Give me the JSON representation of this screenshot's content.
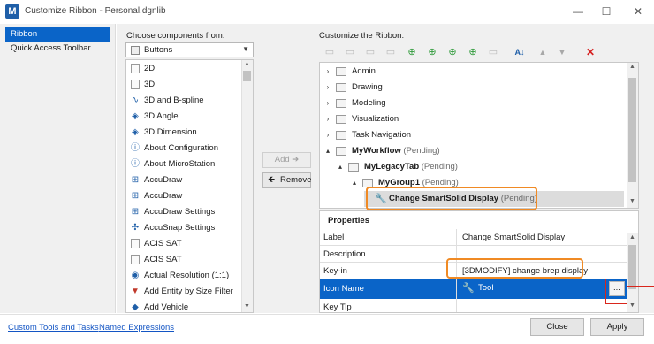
{
  "window": {
    "title": "Customize Ribbon - Personal.dgnlib",
    "app_icon_text": "M",
    "minimize": "—",
    "maximize": "☐",
    "close": "✕"
  },
  "nav": {
    "items": [
      {
        "label": "Ribbon",
        "selected": true
      },
      {
        "label": "Quick Access Toolbar",
        "selected": false
      }
    ]
  },
  "components": {
    "label": "Choose components from:",
    "dropdown_value": "Buttons",
    "items": [
      {
        "label": "2D",
        "icon": "box"
      },
      {
        "label": "3D",
        "icon": "box"
      },
      {
        "label": "3D and B-spline",
        "icon": "curve"
      },
      {
        "label": "3D Angle",
        "icon": "cube"
      },
      {
        "label": "3D Dimension",
        "icon": "cube"
      },
      {
        "label": "About Configuration",
        "icon": "info"
      },
      {
        "label": "About MicroStation",
        "icon": "info"
      },
      {
        "label": "AccuDraw",
        "icon": "accudraw"
      },
      {
        "label": "AccuDraw",
        "icon": "accudraw"
      },
      {
        "label": "AccuDraw Settings",
        "icon": "accudraw"
      },
      {
        "label": "AccuSnap Settings",
        "icon": "snap"
      },
      {
        "label": "ACIS SAT",
        "icon": "box"
      },
      {
        "label": "ACIS SAT",
        "icon": "box"
      },
      {
        "label": "Actual Resolution (1:1)",
        "icon": "resolution"
      },
      {
        "label": "Add Entity by Size Filter",
        "icon": "filter"
      },
      {
        "label": "Add Vehicle",
        "icon": "vehicle"
      }
    ]
  },
  "middle_buttons": {
    "add": "Add ➔",
    "remove": "Remove"
  },
  "ribbon": {
    "label": "Customize the Ribbon:",
    "tree": [
      {
        "label": "Admin",
        "pending": "",
        "expander": "›",
        "indent": 0,
        "bold": false
      },
      {
        "label": "Drawing",
        "pending": "",
        "expander": "›",
        "indent": 0,
        "bold": false
      },
      {
        "label": "Modeling",
        "pending": "",
        "expander": "›",
        "indent": 0,
        "bold": false
      },
      {
        "label": "Visualization",
        "pending": "",
        "expander": "›",
        "indent": 0,
        "bold": false
      },
      {
        "label": "Task Navigation",
        "pending": "",
        "expander": "›",
        "indent": 0,
        "bold": false
      },
      {
        "label": "MyWorkflow",
        "pending": "(Pending)",
        "expander": "▴",
        "indent": 0,
        "bold": true
      },
      {
        "label": "MyLegacyTab",
        "pending": "(Pending)",
        "expander": "▴",
        "indent": 1,
        "bold": true
      },
      {
        "label": "MyGroup1",
        "pending": "(Pending)",
        "expander": "▴",
        "indent": 2,
        "bold": true
      },
      {
        "label": "Change SmartSolid Display",
        "pending": "(Pending)",
        "expander": "",
        "indent": 3,
        "bold": true
      }
    ]
  },
  "properties": {
    "header": "Properties",
    "rows": [
      {
        "key": "Label",
        "value": "Change SmartSolid Display"
      },
      {
        "key": "Description",
        "value": ""
      },
      {
        "key": "Key-in",
        "value": "[3DMODIFY] change brep display"
      },
      {
        "key": "Icon Name",
        "value": "Tool"
      },
      {
        "key": "Key Tip",
        "value": ""
      }
    ],
    "browse_button": "..."
  },
  "footer": {
    "link1": "Custom Tools and Tasks",
    "link2": "Named Expressions",
    "close": "Close",
    "apply": "Apply"
  },
  "colors": {
    "selection": "#0a64c8",
    "highlight_orange": "#f08a24",
    "highlight_red": "#d9261c",
    "delete_red": "#d62020",
    "add_green": "#2f9a3a"
  }
}
